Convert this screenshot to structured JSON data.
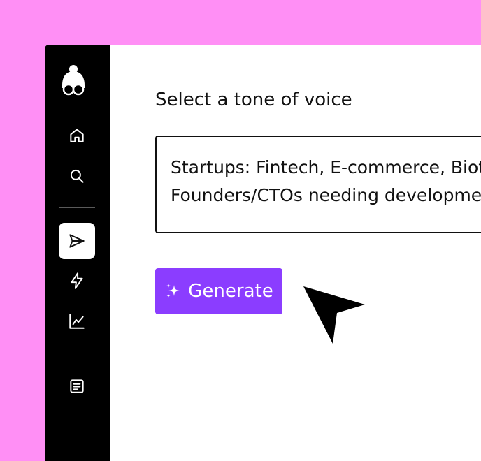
{
  "app": {
    "background_color": "#ff8ff5",
    "accent_color": "#8b3dff"
  },
  "sidebar": {
    "logo_icon": "character-with-glasses-logo",
    "items": [
      {
        "name": "home",
        "icon": "home-icon",
        "active": false
      },
      {
        "name": "search",
        "icon": "search-icon",
        "active": false
      },
      {
        "name": "send",
        "icon": "send-icon",
        "active": true
      },
      {
        "name": "lightning",
        "icon": "lightning-icon",
        "active": false
      },
      {
        "name": "analytics",
        "icon": "line-chart-icon",
        "active": false
      },
      {
        "name": "documents",
        "icon": "document-icon",
        "active": false
      }
    ]
  },
  "main": {
    "tone_label": "Select a tone of voice",
    "tone_text": "Startups: Fintech, E-commerce, Biotech\nFounders/CTOs needing development",
    "generate_button": {
      "label": "Generate",
      "icon": "sparkle-icon"
    },
    "cursor_icon": "pointer-arrow-icon"
  }
}
